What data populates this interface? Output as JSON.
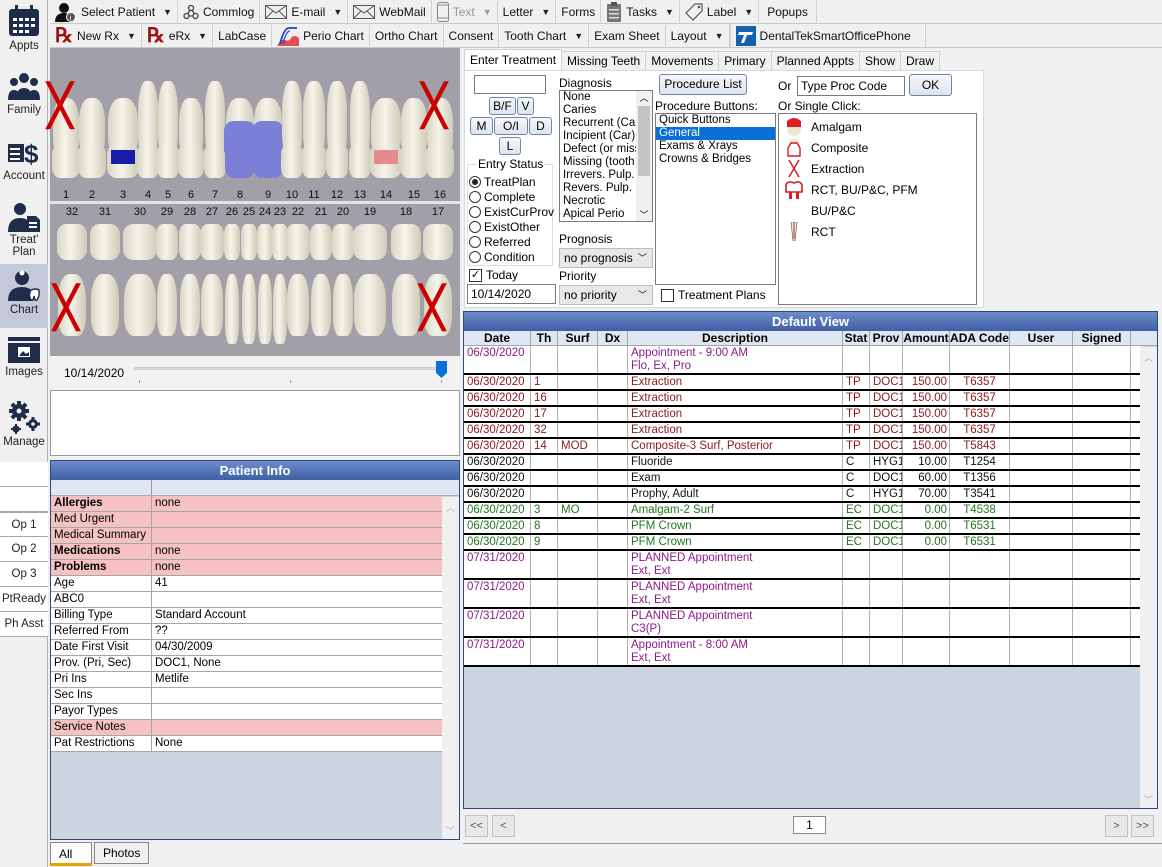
{
  "modules": [
    {
      "label": "Appts",
      "icon": "calendar-icon"
    },
    {
      "label": "Family",
      "icon": "family-icon"
    },
    {
      "label": "Account",
      "icon": "account-dollar-icon"
    },
    {
      "label": "Treat' Plan",
      "icon": "treatment-plan-icon"
    },
    {
      "label": "Chart",
      "icon": "chart-dentist-icon",
      "active": true
    },
    {
      "label": "Images",
      "icon": "images-folder-icon"
    },
    {
      "label": "Manage",
      "icon": "gears-icon"
    }
  ],
  "op_buttons": [
    "Op 1",
    "Op 2",
    "Op 3",
    "PtReady",
    "Ph Asst"
  ],
  "toolbar_main": [
    {
      "label": "Select Patient",
      "icon": "patient-icon",
      "dropdown": true
    },
    {
      "label": "Commlog",
      "icon": "commlog-icon",
      "dropdown": false
    },
    {
      "label": "E-mail",
      "icon": "email-icon",
      "dropdown": true
    },
    {
      "label": "WebMail",
      "icon": "webmail-icon",
      "dropdown": false
    },
    {
      "label": "Text",
      "icon": "phone-icon",
      "dropdown": true,
      "disabled": true
    },
    {
      "label": "Letter",
      "dropdown": true
    },
    {
      "label": "Forms",
      "dropdown": false
    },
    {
      "label": "Tasks",
      "icon": "clipboard-icon",
      "dropdown": true
    },
    {
      "label": "Label",
      "icon": "label-tag-icon",
      "dropdown": true
    },
    {
      "label": "Popups",
      "dropdown": false
    }
  ],
  "toolbar_chart": [
    {
      "label": "New Rx",
      "icon": "rx-icon",
      "dropdown": true
    },
    {
      "label": "eRx",
      "icon": "rx-icon",
      "dropdown": true
    },
    {
      "label": "LabCase",
      "dropdown": false
    },
    {
      "label": "Perio Chart",
      "icon": "perio-chart-icon",
      "dropdown": false
    },
    {
      "label": "Ortho Chart",
      "dropdown": false
    },
    {
      "label": "Consent",
      "dropdown": false
    },
    {
      "label": "Tooth Chart",
      "dropdown": true
    },
    {
      "label": "Exam Sheet",
      "dropdown": false
    },
    {
      "label": "Layout",
      "dropdown": true
    },
    {
      "label": "DentalTekSmartOfficePhone",
      "icon": "dentaltek-icon",
      "dropdown": false
    }
  ],
  "tooth_chart": {
    "upper_numbers": [
      "1",
      "2",
      "3",
      "4",
      "5",
      "6",
      "7",
      "8",
      "9",
      "10",
      "11",
      "12",
      "13",
      "14",
      "15",
      "16"
    ],
    "lower_numbers": [
      "32",
      "31",
      "30",
      "29",
      "28",
      "27",
      "26",
      "25",
      "24",
      "23",
      "22",
      "21",
      "20",
      "19",
      "18",
      "17"
    ],
    "extracted_planned": [
      "1",
      "16",
      "17",
      "32"
    ],
    "existing_crowns": [
      "8",
      "9"
    ],
    "existing_amalgam": [
      "3"
    ],
    "planned_composite": [
      "14"
    ],
    "colors": {
      "extraction": "#cc0000",
      "crown": "#7b7fd6",
      "amalgam": "#1a1aa8",
      "composite_planned": "#e58a8e"
    }
  },
  "slider": {
    "date": "10/14/2020",
    "position": 1.0
  },
  "enter_treatment": {
    "tabs": [
      "Enter Treatment",
      "Missing Teeth",
      "Movements",
      "Primary",
      "Planned Appts",
      "Show",
      "Draw"
    ],
    "active_tab": "Enter Treatment",
    "surface_input": "",
    "surface_buttons": {
      "bf": "B/F",
      "v": "V",
      "m": "M",
      "oi": "O/I",
      "d": "D",
      "l": "L"
    },
    "entry_status_label": "Entry Status",
    "entry_status": [
      "TreatPlan",
      "Complete",
      "ExistCurProv",
      "ExistOther",
      "Referred",
      "Condition"
    ],
    "entry_status_selected": "TreatPlan",
    "today_label": "Today",
    "today_checked": true,
    "date_value": "10/14/2020",
    "diagnosis_label": "Diagnosis",
    "diagnosis_items": [
      "None",
      "Caries",
      "Recurrent (Car)",
      "Incipient (Car)",
      "Defect (or miss",
      "Missing (tooth s",
      "Irrevers. Pulp.",
      "Revers. Pulp.",
      "Necrotic",
      "Apical Perio"
    ],
    "prognosis_label": "Prognosis",
    "prognosis_value": "no prognosis",
    "priority_label": "Priority",
    "priority_value": "no priority",
    "procedure_list_button": "Procedure List",
    "procedure_buttons_label": "Procedure Buttons:",
    "procedure_categories": [
      "Quick Buttons",
      "General",
      "Exams & Xrays",
      "Crowns & Bridges"
    ],
    "procedure_category_selected": "General",
    "treatment_plans_label": "Treatment Plans",
    "treatment_plans_checked": false,
    "or_label": "Or",
    "proc_code_value": "Type Proc Code",
    "ok_button": "OK",
    "single_click_label": "Or Single Click:",
    "single_click_items": [
      {
        "label": "Amalgam",
        "icon": "amalgam-icon"
      },
      {
        "label": "Composite",
        "icon": "composite-icon"
      },
      {
        "label": "Extraction",
        "icon": "extraction-icon"
      },
      {
        "label": "RCT, BU/P&C, PFM",
        "icon": "crown-icon"
      },
      {
        "label": "BU/P&C",
        "icon": ""
      },
      {
        "label": "RCT",
        "icon": "root-canal-icon"
      }
    ]
  },
  "patient_info": {
    "title": "Patient Info",
    "rows": [
      {
        "key": "Allergies",
        "value": "none",
        "pink": true,
        "bold": true
      },
      {
        "key": "Med Urgent",
        "value": "",
        "pink": true,
        "bold": false
      },
      {
        "key": "Medical Summary",
        "value": "",
        "pink": true,
        "bold": false
      },
      {
        "key": "Medications",
        "value": "none",
        "pink": true,
        "bold": true
      },
      {
        "key": "Problems",
        "value": "none",
        "pink": true,
        "bold": true
      },
      {
        "key": "Age",
        "value": "41",
        "pink": false,
        "bold": false
      },
      {
        "key": "ABC0",
        "value": "",
        "pink": false,
        "bold": false
      },
      {
        "key": "Billing Type",
        "value": "Standard Account",
        "pink": false,
        "bold": false
      },
      {
        "key": "Referred From",
        "value": "??",
        "pink": false,
        "bold": false
      },
      {
        "key": "Date First Visit",
        "value": "04/30/2009",
        "pink": false,
        "bold": false
      },
      {
        "key": "Prov. (Pri, Sec)",
        "value": "DOC1, None",
        "pink": false,
        "bold": false
      },
      {
        "key": "Pri Ins",
        "value": "Metlife",
        "pink": false,
        "bold": false
      },
      {
        "key": "Sec Ins",
        "value": "",
        "pink": false,
        "bold": false
      },
      {
        "key": "Payor Types",
        "value": "",
        "pink": false,
        "bold": false
      },
      {
        "key": "Service Notes",
        "value": "",
        "pink": true,
        "bold": false
      },
      {
        "key": "Pat Restrictions",
        "value": "None",
        "pink": false,
        "bold": false
      }
    ]
  },
  "progress_notes": {
    "title": "Default View",
    "columns": [
      "Date",
      "Th",
      "Surf",
      "Dx",
      "Description",
      "Stat",
      "Prov",
      "Amount",
      "ADA Code",
      "User",
      "Signed"
    ],
    "colors": {
      "appt": "#8b1a8b",
      "tp": "#8b1a1a",
      "c": "#111111",
      "ec": "#1f7a1f"
    },
    "rows": [
      {
        "date": "06/30/2020",
        "th": "",
        "surf": "",
        "dx": "",
        "desc": "Appointment - 9:00 AM",
        "desc2": "Flo, Ex, Pro",
        "stat": "",
        "prov": "",
        "amount": "",
        "code": "",
        "user": "",
        "signed": "",
        "kind": "appt"
      },
      {
        "date": "06/30/2020",
        "th": "1",
        "surf": "",
        "dx": "",
        "desc": "Extraction",
        "desc2": "",
        "stat": "TP",
        "prov": "DOC1",
        "amount": "150.00",
        "code": "T6357",
        "user": "",
        "signed": "",
        "kind": "tp"
      },
      {
        "date": "06/30/2020",
        "th": "16",
        "surf": "",
        "dx": "",
        "desc": "Extraction",
        "desc2": "",
        "stat": "TP",
        "prov": "DOC1",
        "amount": "150.00",
        "code": "T6357",
        "user": "",
        "signed": "",
        "kind": "tp"
      },
      {
        "date": "06/30/2020",
        "th": "17",
        "surf": "",
        "dx": "",
        "desc": "Extraction",
        "desc2": "",
        "stat": "TP",
        "prov": "DOC1",
        "amount": "150.00",
        "code": "T6357",
        "user": "",
        "signed": "",
        "kind": "tp"
      },
      {
        "date": "06/30/2020",
        "th": "32",
        "surf": "",
        "dx": "",
        "desc": "Extraction",
        "desc2": "",
        "stat": "TP",
        "prov": "DOC1",
        "amount": "150.00",
        "code": "T6357",
        "user": "",
        "signed": "",
        "kind": "tp"
      },
      {
        "date": "06/30/2020",
        "th": "14",
        "surf": "MOD",
        "dx": "",
        "desc": "Composite-3 Surf, Posterior",
        "desc2": "",
        "stat": "TP",
        "prov": "DOC1",
        "amount": "150.00",
        "code": "T5843",
        "user": "",
        "signed": "",
        "kind": "tp"
      },
      {
        "date": "06/30/2020",
        "th": "",
        "surf": "",
        "dx": "",
        "desc": "Fluoride",
        "desc2": "",
        "stat": "C",
        "prov": "HYG1",
        "amount": "10.00",
        "code": "T1254",
        "user": "",
        "signed": "",
        "kind": "c"
      },
      {
        "date": "06/30/2020",
        "th": "",
        "surf": "",
        "dx": "",
        "desc": "Exam",
        "desc2": "",
        "stat": "C",
        "prov": "DOC1",
        "amount": "60.00",
        "code": "T1356",
        "user": "",
        "signed": "",
        "kind": "c"
      },
      {
        "date": "06/30/2020",
        "th": "",
        "surf": "",
        "dx": "",
        "desc": "Prophy, Adult",
        "desc2": "",
        "stat": "C",
        "prov": "HYG1",
        "amount": "70.00",
        "code": "T3541",
        "user": "",
        "signed": "",
        "kind": "c"
      },
      {
        "date": "06/30/2020",
        "th": "3",
        "surf": "MO",
        "dx": "",
        "desc": "Amalgam-2 Surf",
        "desc2": "",
        "stat": "EC",
        "prov": "DOC1",
        "amount": "0.00",
        "code": "T4538",
        "user": "",
        "signed": "",
        "kind": "ec"
      },
      {
        "date": "06/30/2020",
        "th": "8",
        "surf": "",
        "dx": "",
        "desc": "PFM Crown",
        "desc2": "",
        "stat": "EC",
        "prov": "DOC1",
        "amount": "0.00",
        "code": "T6531",
        "user": "",
        "signed": "",
        "kind": "ec"
      },
      {
        "date": "06/30/2020",
        "th": "9",
        "surf": "",
        "dx": "",
        "desc": "PFM Crown",
        "desc2": "",
        "stat": "EC",
        "prov": "DOC1",
        "amount": "0.00",
        "code": "T6531",
        "user": "",
        "signed": "",
        "kind": "ec"
      },
      {
        "date": "07/31/2020",
        "th": "",
        "surf": "",
        "dx": "",
        "desc": "PLANNED Appointment",
        "desc2": "Ext, Ext",
        "stat": "",
        "prov": "",
        "amount": "",
        "code": "",
        "user": "",
        "signed": "",
        "kind": "appt"
      },
      {
        "date": "07/31/2020",
        "th": "",
        "surf": "",
        "dx": "",
        "desc": "PLANNED Appointment",
        "desc2": "Ext, Ext",
        "stat": "",
        "prov": "",
        "amount": "",
        "code": "",
        "user": "",
        "signed": "",
        "kind": "appt"
      },
      {
        "date": "07/31/2020",
        "th": "",
        "surf": "",
        "dx": "",
        "desc": "PLANNED Appointment",
        "desc2": "C3(P)",
        "stat": "",
        "prov": "",
        "amount": "",
        "code": "",
        "user": "",
        "signed": "",
        "kind": "appt"
      },
      {
        "date": "07/31/2020",
        "th": "",
        "surf": "",
        "dx": "",
        "desc": "Appointment - 8:00 AM",
        "desc2": "Ext, Ext",
        "stat": "",
        "prov": "",
        "amount": "",
        "code": "",
        "user": "",
        "signed": "",
        "kind": "appt"
      }
    ]
  },
  "pager": {
    "first": "<<",
    "prev": "<",
    "page": "1",
    "next": ">",
    "last": ">>"
  },
  "bottom_tabs": [
    "All",
    "Photos"
  ],
  "bottom_tab_active": "All"
}
